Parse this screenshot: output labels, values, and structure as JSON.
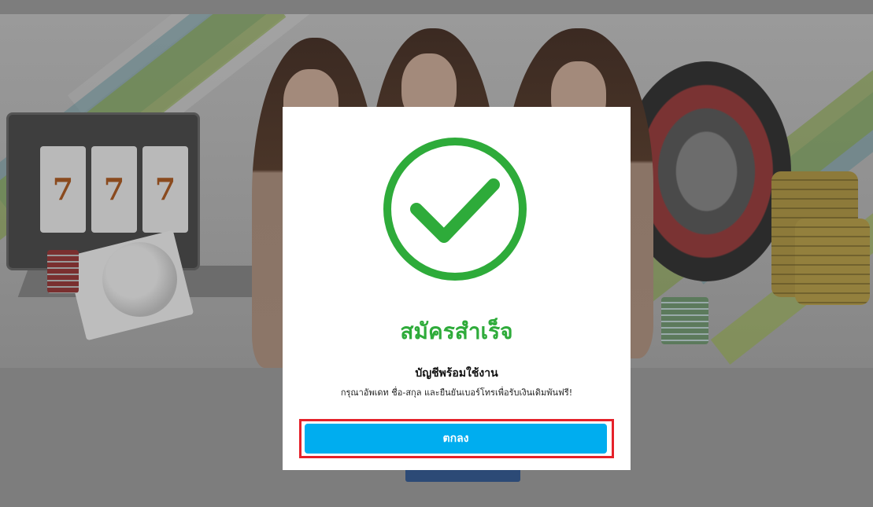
{
  "modal": {
    "title": "สมัครสำเร็จ",
    "subtitle": "บัญชีพร้อมใช้งาน",
    "description": "กรุณาอัพเดท ชื่อ-สกุล และยืนยันเบอร์โทรเพื่อรับเงินเดิมพันฟรี!",
    "ok_label": "ตกลง",
    "icon": "check-circle-icon"
  },
  "background": {
    "slot_reels": [
      "7",
      "7",
      "7"
    ]
  },
  "colors": {
    "success_green": "#2eab3a",
    "button_blue": "#00adef",
    "highlight_red": "#e5222a",
    "overlay_gray": "#7d7d7d"
  }
}
